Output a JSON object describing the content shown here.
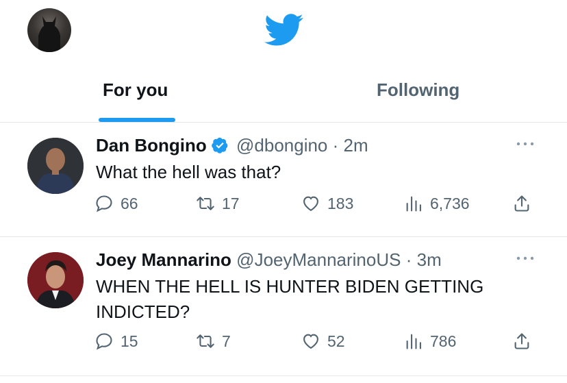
{
  "tabs": {
    "for_you": "For you",
    "following": "Following"
  },
  "colors": {
    "accent": "#1d9bf0",
    "text": "#0f1419",
    "muted": "#536471",
    "divider": "#e4e8eb"
  },
  "tweets": [
    {
      "name": "Dan Bongino",
      "verified": true,
      "handle": "@dbongino",
      "separator": "·",
      "time": "2m",
      "text": "What the hell was that?",
      "replies": "66",
      "retweets": "17",
      "likes": "183",
      "views": "6,736"
    },
    {
      "name": "Joey Mannarino",
      "verified": false,
      "handle": "@JoeyMannarinoUS",
      "separator": "·",
      "time": "3m",
      "text": "WHEN THE HELL IS HUNTER BIDEN GETTING INDICTED?",
      "replies": "15",
      "retweets": "7",
      "likes": "52",
      "views": "786"
    }
  ],
  "icons": {
    "logo": "twitter-bird-icon",
    "verified": "verified-badge-icon",
    "more": "more-dots-icon",
    "reply": "reply-icon",
    "retweet": "retweet-icon",
    "like": "heart-icon",
    "views": "views-chart-icon",
    "share": "share-icon"
  }
}
